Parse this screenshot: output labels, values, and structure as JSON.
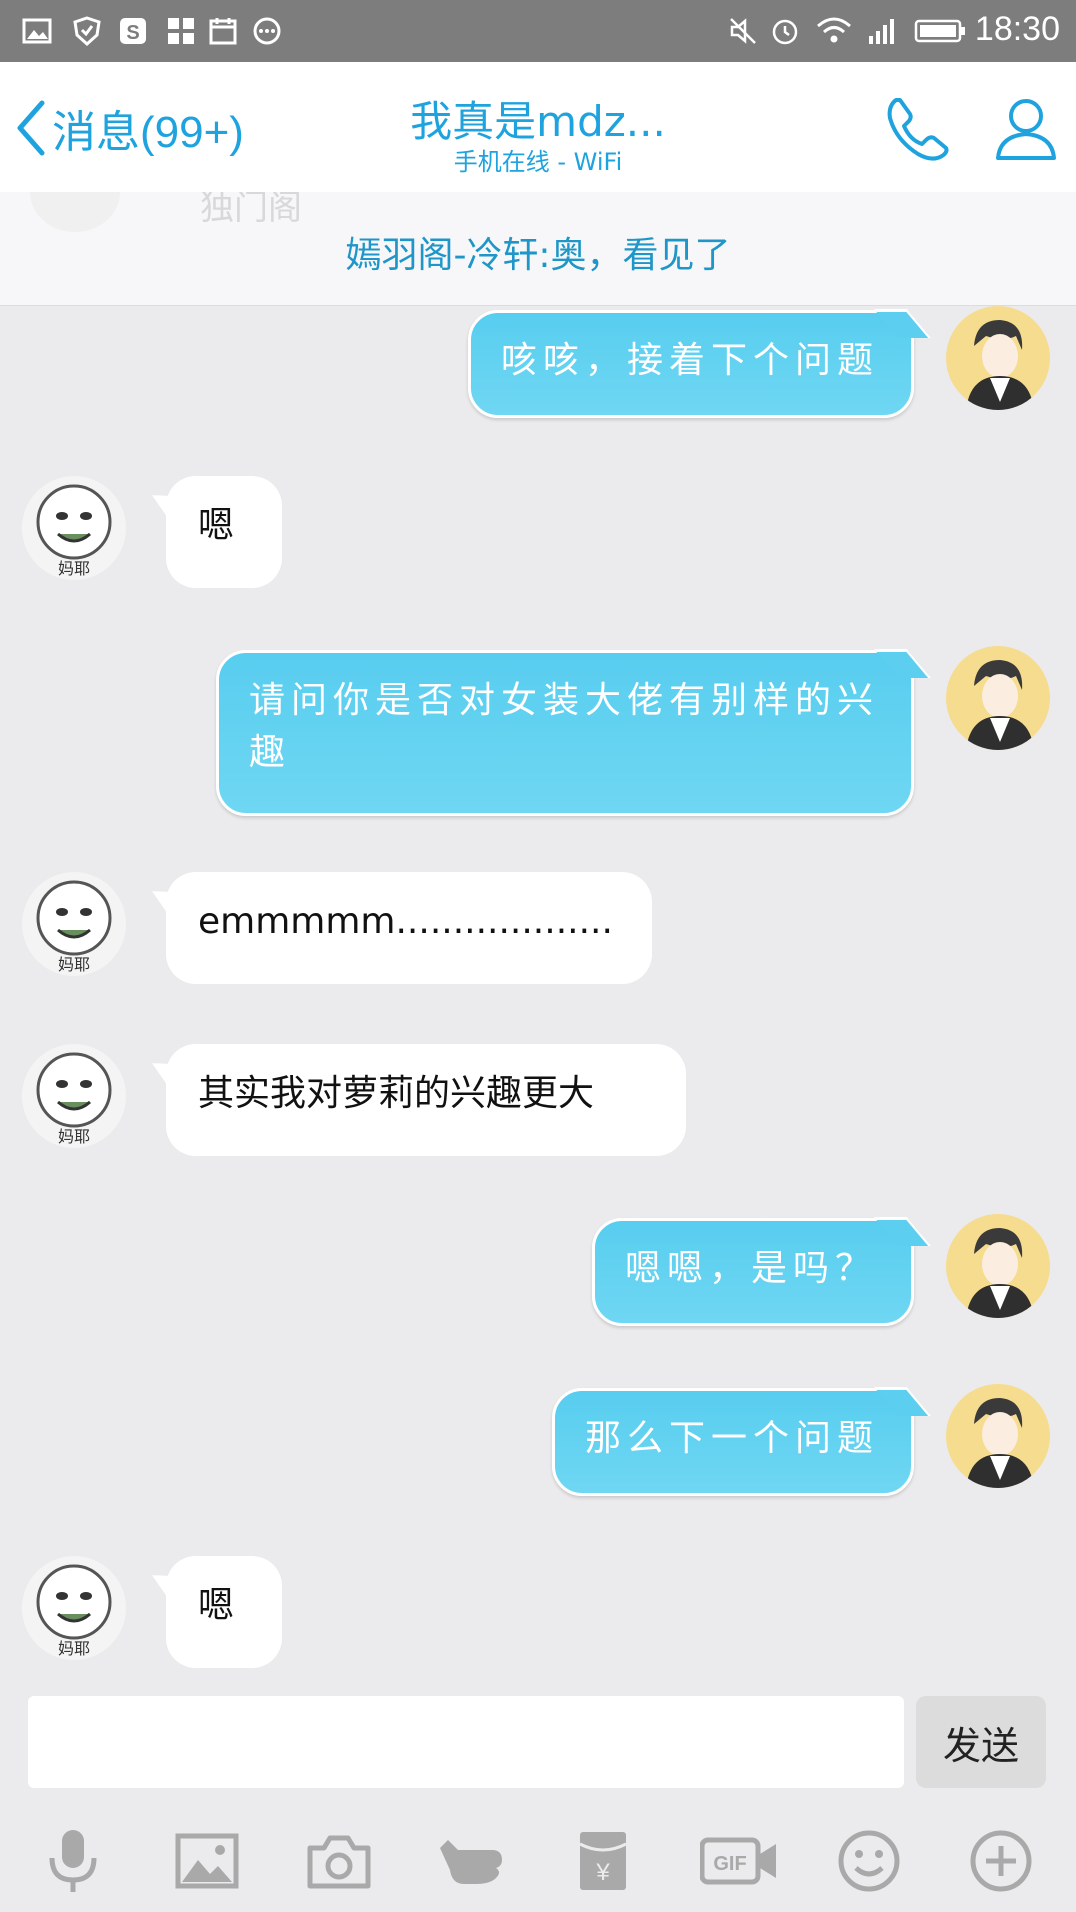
{
  "status_bar": {
    "time": "18:30"
  },
  "header": {
    "back_label": "消息(99+)",
    "title": "我真是mdz...",
    "subtitle": "手机在线 - WiFi"
  },
  "notice": {
    "ghost_text": "独门阁",
    "text": "嫣羽阁-冷轩:奥，看见了"
  },
  "avatar_other_caption": "妈耶",
  "messages": [
    {
      "from": "me",
      "text": "咳咳，接着下个问题"
    },
    {
      "from": "other",
      "text": "嗯"
    },
    {
      "from": "me",
      "text": "请问你是否对女装大佬有别样的兴趣"
    },
    {
      "from": "other",
      "text": "emmmmm..................."
    },
    {
      "from": "other",
      "text": "其实我对萝莉的兴趣更大"
    },
    {
      "from": "me",
      "text": "嗯嗯，是吗？"
    },
    {
      "from": "me",
      "text": "那么下一个问题"
    },
    {
      "from": "other",
      "text": "嗯"
    }
  ],
  "input": {
    "value": "",
    "placeholder": ""
  },
  "send_label": "发送",
  "colors": {
    "accent": "#1fa3de",
    "my_bubble": "#5ccff0",
    "status_bar": "#7d7d7d"
  },
  "toolbar_icons": [
    "microphone-icon",
    "image-icon",
    "camera-icon",
    "poke-icon",
    "red-packet-icon",
    "gif-icon",
    "emoji-icon",
    "plus-icon"
  ]
}
